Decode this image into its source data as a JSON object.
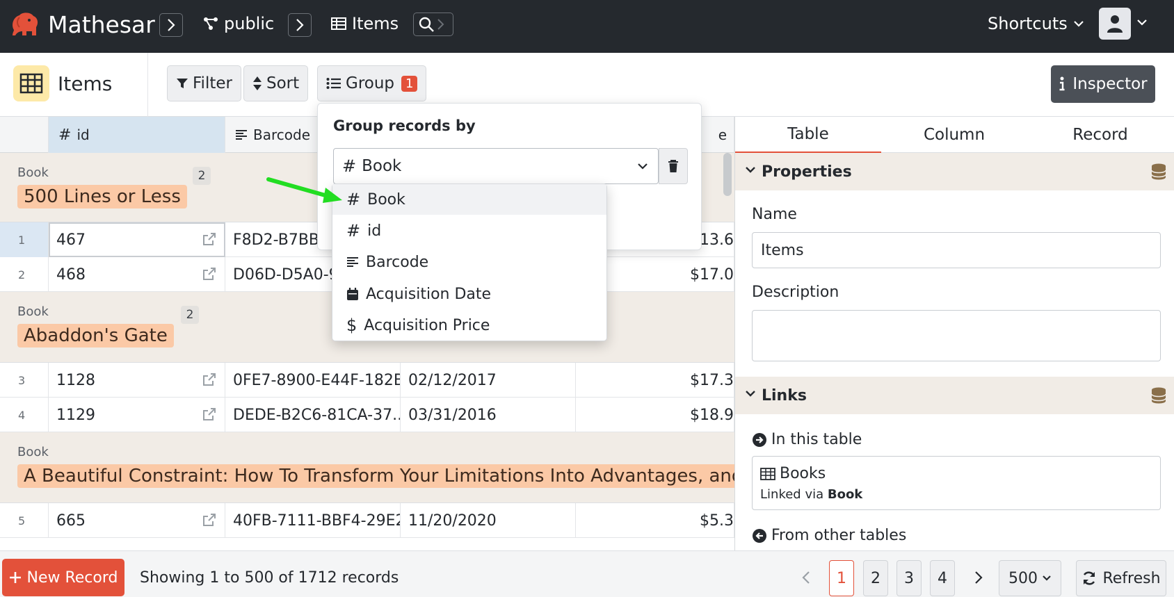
{
  "header": {
    "brand": "Mathesar",
    "schema": "public",
    "table": "Items",
    "shortcuts": "Shortcuts"
  },
  "toolbar": {
    "table_name": "Items",
    "filter": "Filter",
    "sort": "Sort",
    "group": "Group",
    "group_count": "1",
    "inspector": "Inspector"
  },
  "grid": {
    "columns": [
      "id",
      "Barcode",
      "e"
    ],
    "groups": [
      {
        "label": "Book",
        "count": "2",
        "value": "500 Lines or Less"
      },
      {
        "label": "Book",
        "count": "2",
        "value": "Abaddon's Gate"
      },
      {
        "label": "Book",
        "value": "A Beautiful Constraint: How To Transform Your Limitations Into Advantages, and W"
      }
    ],
    "rows": [
      {
        "num": "1",
        "id": "467",
        "barcode": "F8D2-B7BB-",
        "date": "",
        "price": "$13.6"
      },
      {
        "num": "2",
        "id": "468",
        "barcode": "D06D-D5A0-9",
        "date": "",
        "price": "$17.0"
      },
      {
        "num": "3",
        "id": "1128",
        "barcode": "0FE7-8900-E44F-182B",
        "date": "02/12/2017",
        "price": "$17.3"
      },
      {
        "num": "4",
        "id": "1129",
        "barcode": "DEDE-B2C6-81CA-37...",
        "date": "03/31/2016",
        "price": "$18.9"
      },
      {
        "num": "5",
        "id": "665",
        "barcode": "40FB-7111-BBF4-29E2",
        "date": "11/20/2020",
        "price": "$5.3"
      }
    ]
  },
  "group_popover": {
    "title": "Group records by",
    "selected": "Book",
    "options": [
      "Book",
      "id",
      "Barcode",
      "Acquisition Date",
      "Acquisition Price"
    ]
  },
  "inspector": {
    "tabs": [
      "Table",
      "Column",
      "Record"
    ],
    "properties_title": "Properties",
    "name_label": "Name",
    "name_value": "Items",
    "description_label": "Description",
    "description_value": "",
    "links_title": "Links",
    "in_this_table": "In this table",
    "link_table": "Books",
    "linked_via_prefix": "Linked via",
    "linked_via_col": "Book",
    "from_other_tables": "From other tables"
  },
  "footer": {
    "new_record": "New Record",
    "showing": "Showing 1 to 500 of 1712 records",
    "pages": [
      "1",
      "2",
      "3",
      "4"
    ],
    "per_page": "500",
    "refresh": "Refresh"
  },
  "colors": {
    "accent": "#e3513a",
    "header_bg": "#25292e",
    "group_bg": "#f1ece6",
    "group_value_bg": "#fbc9a6",
    "arrow": "#22dd22"
  }
}
